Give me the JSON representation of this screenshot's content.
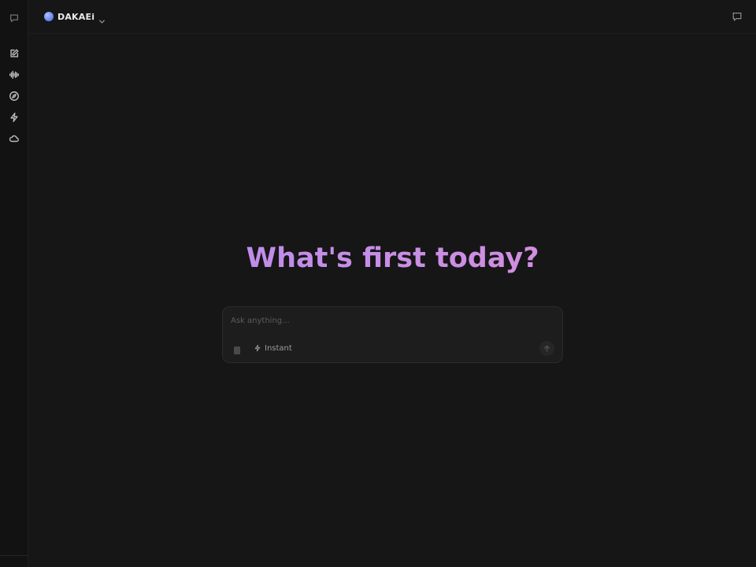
{
  "topbar": {
    "model_name": "DAKAEi",
    "model_dot_color": "#6d8df5"
  },
  "sidebar": {
    "items": [
      {
        "name": "chats",
        "icon": "chat-bubble-icon"
      },
      {
        "name": "new-chat",
        "icon": "compose-icon"
      },
      {
        "name": "voice",
        "icon": "waveform-icon"
      },
      {
        "name": "explore",
        "icon": "compass-icon"
      },
      {
        "name": "actions",
        "icon": "lightning-icon"
      },
      {
        "name": "cloud",
        "icon": "cloud-icon"
      }
    ]
  },
  "main": {
    "headline": "What's first today?",
    "headline_gradient": [
      "#b48bf0",
      "#e08ed6"
    ]
  },
  "composer": {
    "placeholder": "Ask anything...",
    "mode_label": "Instant"
  }
}
